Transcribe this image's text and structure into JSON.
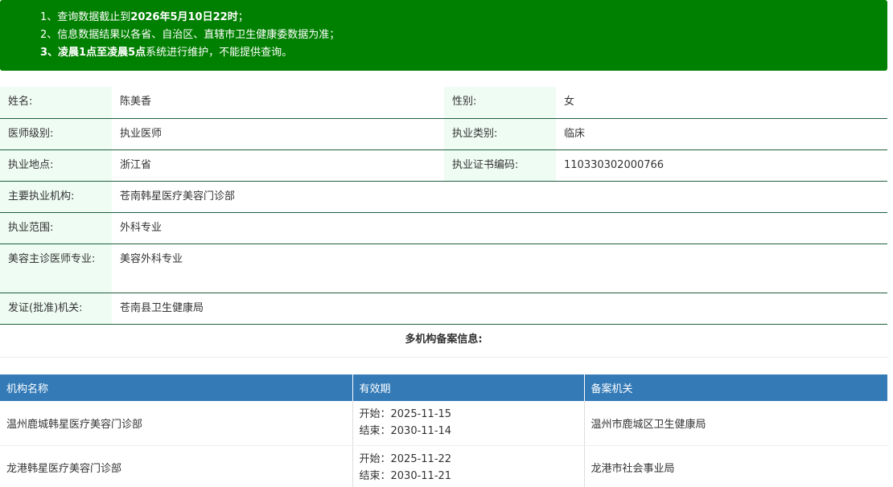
{
  "notice": {
    "line1_prefix": "1、查询数据截止到",
    "line1_bold": "2026年5月10日22时",
    "line1_suffix": "；",
    "line2": "2、信息数据结果以各省、自治区、直辖市卫生健康委数据为准；",
    "line3_prefix": "3、",
    "line3_bold": "凌晨1点至凌晨5点",
    "line3_suffix": "系统进行维护，不能提供查询。"
  },
  "info": {
    "name_label": "姓名:",
    "name_value": "陈美香",
    "gender_label": "性别:",
    "gender_value": "女",
    "level_label": "医师级别:",
    "level_value": "执业医师",
    "category_label": "执业类别:",
    "category_value": "临床",
    "location_label": "执业地点:",
    "location_value": "浙江省",
    "cert_label": "执业证书编码:",
    "cert_value": "110330302000766",
    "institution_label": "主要执业机构:",
    "institution_value": "苍南韩星医疗美容门诊部",
    "scope_label": "执业范围:",
    "scope_value": "外科专业",
    "cosmetic_label": "美容主诊医师专业:",
    "cosmetic_value": "美容外科专业",
    "issuer_label": "发证(批准)机关:",
    "issuer_value": "苍南县卫生健康局"
  },
  "multi_title": "多机构备案信息:",
  "filing": {
    "headers": [
      "机构名称",
      "有效期",
      "备案机关"
    ],
    "rows": [
      {
        "name": "温州鹿城韩星医疗美容门诊部",
        "start": "开始：2025-11-15",
        "end": "结束：2030-11-14",
        "authority": "温州市鹿城区卫生健康局"
      },
      {
        "name": "龙港韩星医疗美容门诊部",
        "start": "开始：2025-11-22",
        "end": "结束：2030-11-21",
        "authority": "龙港市社会事业局"
      }
    ]
  },
  "colors": {
    "notice_bg": "#008000",
    "label_bg": "#effcf4",
    "row_border": "#1f5f3f",
    "table_header_bg": "#337ab7"
  }
}
